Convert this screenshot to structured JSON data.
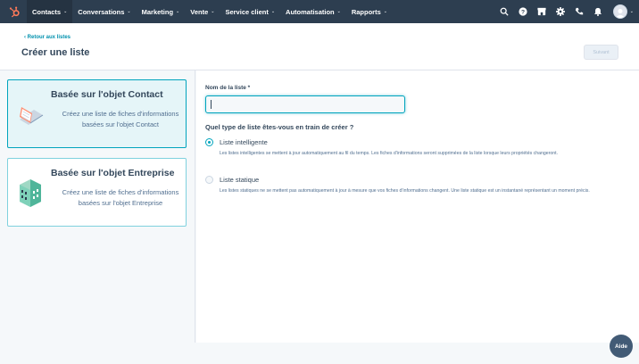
{
  "nav": {
    "items": [
      {
        "label": "Contacts",
        "active": true
      },
      {
        "label": "Conversations",
        "active": false
      },
      {
        "label": "Marketing",
        "active": false
      },
      {
        "label": "Vente",
        "active": false
      },
      {
        "label": "Service client",
        "active": false
      },
      {
        "label": "Automatisation",
        "active": false
      },
      {
        "label": "Rapports",
        "active": false
      }
    ],
    "icons": [
      "search-icon",
      "help-icon",
      "marketplace-icon",
      "settings-icon",
      "calling-icon",
      "notifications-icon"
    ]
  },
  "header": {
    "back_link": "‹ Retour aux listes",
    "title": "Créer une liste",
    "next_label": "Suivant"
  },
  "cards": [
    {
      "title": "Basée sur l'objet Contact",
      "description": "Créez une liste de fiches d'informations basées sur l'objet Contact",
      "selected": true,
      "icon": "contact-laptop-icon"
    },
    {
      "title": "Basée sur l'objet Entreprise",
      "description": "Créez une liste de fiches d'informations basées sur l'objet Entreprise",
      "selected": false,
      "icon": "company-building-icon"
    }
  ],
  "form": {
    "name_label": "Nom de la liste *",
    "name_value": "",
    "question": "Quel type de liste êtes-vous en train de créer ?",
    "options": [
      {
        "label": "Liste intelligente",
        "description": "Les listes intelligentes se mettent à jour automatiquement au fil du temps. Les fiches d'informations seront supprimées de la liste lorsque leurs propriétés changeront.",
        "checked": true
      },
      {
        "label": "Liste statique",
        "description": "Les listes statiques ne se mettent pas automatiquement à jour à mesure que vos fiches d'informations changent. Une liste statique est un instantané représentant un moment précis.",
        "checked": false
      }
    ]
  },
  "help": {
    "label": "Aide"
  },
  "colors": {
    "nav_bg": "#2d3e50",
    "accent": "#00a4bd",
    "brand": "#ff7a59",
    "link": "#0091ae"
  }
}
